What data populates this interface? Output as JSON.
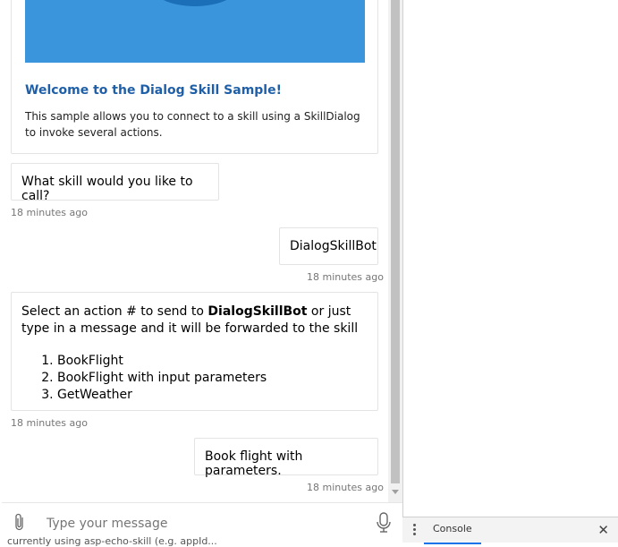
{
  "card": {
    "title": "Welcome to the Dialog Skill Sample!",
    "body": "This sample allows you to connect to a skill using a SkillDialog to invoke several actions."
  },
  "messages": [
    {
      "text": "What skill would you like to call?",
      "timestamp": "18 minutes ago",
      "from": "bot"
    },
    {
      "text": "DialogSkillBot",
      "timestamp": "18 minutes ago",
      "from": "user"
    },
    {
      "text_prefix": "Select an action # to send to ",
      "text_bold": "DialogSkillBot",
      "text_suffix": " or just type in a message and it will be forwarded to the skill",
      "options": [
        "BookFlight",
        "BookFlight with input parameters",
        "GetWeather"
      ],
      "timestamp": "18 minutes ago",
      "from": "bot"
    },
    {
      "text": "Book flight with parameters.",
      "timestamp": "18 minutes ago",
      "from": "user"
    }
  ],
  "input": {
    "placeholder": "Type your message"
  },
  "devtools": {
    "console_tab": "Console",
    "close_label": "✕"
  },
  "background_text": "currently using asp-echo-skill (e.g. appId..."
}
